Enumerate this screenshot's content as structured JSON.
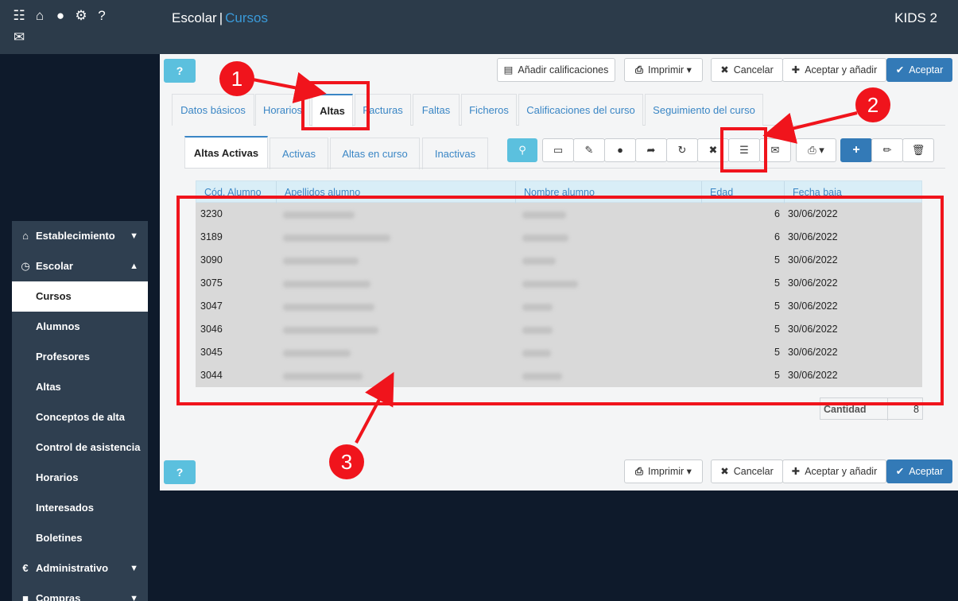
{
  "header": {
    "module": "Escolar",
    "separator": "|",
    "section": "Cursos",
    "company": "KIDS 2",
    "icons": [
      "list-icon",
      "home-icon",
      "user-icon",
      "gear-icon",
      "help-icon",
      "chat-icon"
    ]
  },
  "sidebar": {
    "items": [
      {
        "label": "Establecimiento",
        "icon": "home-icon",
        "chev": "⌄"
      },
      {
        "label": "Escolar",
        "icon": "clock-icon",
        "chev": "⌃"
      },
      {
        "label": "Cursos"
      },
      {
        "label": "Alumnos"
      },
      {
        "label": "Profesores"
      },
      {
        "label": "Altas"
      },
      {
        "label": "Conceptos de alta"
      },
      {
        "label": "Control de asistencia"
      },
      {
        "label": "Horarios"
      },
      {
        "label": "Interesados"
      },
      {
        "label": "Boletines"
      },
      {
        "label": "Administrativo",
        "icon": "euro-icon",
        "chev": "⌄"
      },
      {
        "label": "Compras",
        "icon": "briefcase-icon",
        "chev": "⌄"
      }
    ]
  },
  "top_toolbar": {
    "help": "?",
    "add_grades": "Añadir calificaciones",
    "print": "Imprimir",
    "cancel": "Cancelar",
    "accept_add": "Aceptar y añadir",
    "accept": "Aceptar"
  },
  "tabs": [
    "Datos básicos",
    "Horarios",
    "Altas",
    "Facturas",
    "Faltas",
    "Ficheros",
    "Calificaciones del curso",
    "Seguimiento del curso"
  ],
  "subtabs": [
    "Altas Activas",
    "Activas",
    "Altas en curso",
    "Inactivas"
  ],
  "table": {
    "headers": [
      "Cód. Alumno",
      "Apellidos alumno",
      "Nombre alumno",
      "Edad",
      "Fecha baja"
    ],
    "rows": [
      {
        "code": "3230",
        "age": "6",
        "date": "30/06/2022"
      },
      {
        "code": "3189",
        "age": "6",
        "date": "30/06/2022"
      },
      {
        "code": "3090",
        "age": "5",
        "date": "30/06/2022"
      },
      {
        "code": "3075",
        "age": "5",
        "date": "30/06/2022"
      },
      {
        "code": "3047",
        "age": "5",
        "date": "30/06/2022"
      },
      {
        "code": "3046",
        "age": "5",
        "date": "30/06/2022"
      },
      {
        "code": "3045",
        "age": "5",
        "date": "30/06/2022"
      },
      {
        "code": "3044",
        "age": "5",
        "date": "30/06/2022"
      }
    ]
  },
  "quantity": {
    "label": "Cantidad",
    "value": "8"
  },
  "annotations": [
    "1",
    "2",
    "3"
  ],
  "colors": {
    "annotation": "#f0141c",
    "primary": "#337ab7",
    "info": "#5bc0de",
    "topbar": "#2c3b4a"
  }
}
